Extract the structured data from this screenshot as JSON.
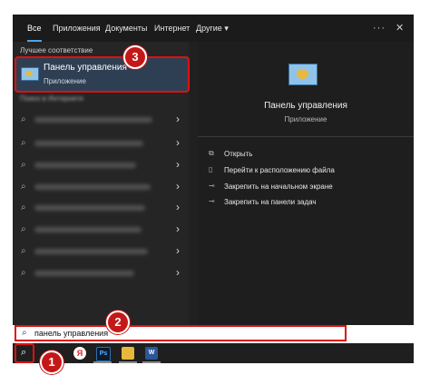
{
  "tabs": [
    {
      "label": "Все",
      "active": true
    },
    {
      "label": "Приложения"
    },
    {
      "label": "Документы"
    },
    {
      "label": "Интернет"
    },
    {
      "label": "Другие ▾"
    }
  ],
  "window_controls": {
    "more": "···",
    "close": "✕"
  },
  "left": {
    "best_match_header": "Лучшее соответствие",
    "best_match": {
      "title": "Панель управления",
      "subtitle": "Приложение",
      "icon": "control-panel-icon"
    },
    "web_header": "Поиск в Интернете",
    "web_results_count": 8
  },
  "right": {
    "title": "Панель управления",
    "subtitle": "Приложение",
    "actions": [
      {
        "label": "Открыть",
        "icon": "open-icon"
      },
      {
        "label": "Перейти к расположению файла",
        "icon": "file-location-icon"
      },
      {
        "label": "Закрепить на начальном экране",
        "icon": "pin-icon"
      },
      {
        "label": "Закрепить на панели задач",
        "icon": "pin-icon"
      }
    ]
  },
  "search": {
    "value": "панель управления",
    "icon": "search-icon"
  },
  "taskbar": {
    "apps": [
      {
        "name": "yandex-browser",
        "label": "Я"
      },
      {
        "name": "photoshop",
        "label": "Ps"
      },
      {
        "name": "file-explorer",
        "label": ""
      },
      {
        "name": "word",
        "label": "W"
      }
    ]
  },
  "badges": [
    "1",
    "2",
    "3"
  ],
  "colors": {
    "accent": "#4ea3e8",
    "highlight": "#d11111",
    "badge": "#c41818"
  }
}
